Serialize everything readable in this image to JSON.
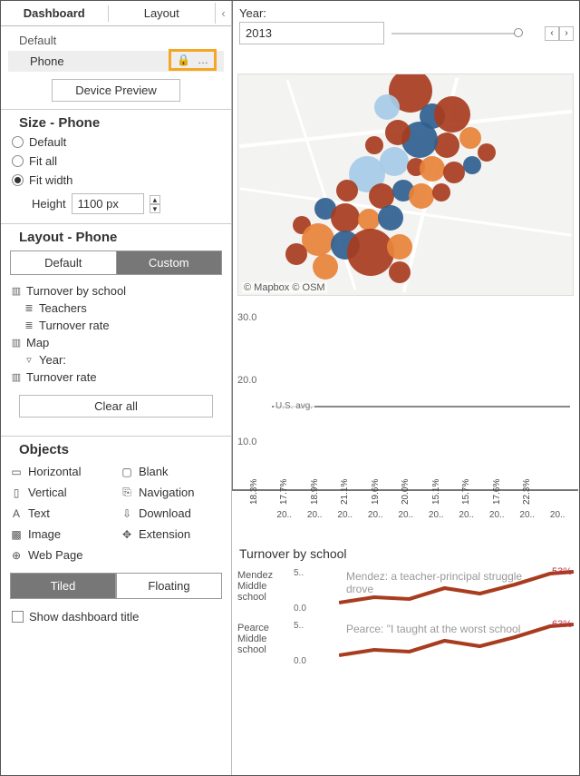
{
  "tabs": {
    "dashboard": "Dashboard",
    "layout": "Layout",
    "collapse": "‹"
  },
  "devices": {
    "default": "Default",
    "phone": "Phone",
    "lock_icon": "🔒",
    "more_icon": "…",
    "preview_btn": "Device Preview"
  },
  "size": {
    "title": "Size - Phone",
    "opt_default": "Default",
    "opt_fitall": "Fit all",
    "opt_fitwidth": "Fit width",
    "height_label": "Height",
    "height_value": "1100 px"
  },
  "layout": {
    "title": "Layout - Phone",
    "seg_default": "Default",
    "seg_custom": "Custom",
    "tree": {
      "n1": "Turnover by school",
      "n2": "Teachers",
      "n3": "Turnover rate",
      "n4": "Map",
      "n5": "Year:",
      "n6": "Turnover rate"
    },
    "clear": "Clear all"
  },
  "objects": {
    "title": "Objects",
    "horizontal": "Horizontal",
    "blank": "Blank",
    "vertical": "Vertical",
    "navigation": "Navigation",
    "text": "Text",
    "download": "Download",
    "image": "Image",
    "extension": "Extension",
    "webpage": "Web Page",
    "tiled": "Tiled",
    "floating": "Floating",
    "show_title": "Show dashboard title"
  },
  "year": {
    "label": "Year:",
    "value": "2013"
  },
  "map": {
    "attrib": "© Mapbox © OSM"
  },
  "chart_data": {
    "type": "bar",
    "title": "",
    "ylabel": "",
    "ylim": [
      0,
      30
    ],
    "yticks": [
      10.0,
      20.0,
      30.0
    ],
    "reference_line": {
      "label": "U.S. avg.",
      "value": 15.9
    },
    "categories": [
      "20..",
      "20..",
      "20..",
      "20..",
      "20..",
      "20..",
      "20..",
      "20..",
      "20..",
      "20.."
    ],
    "values": [
      18.3,
      17.7,
      18.9,
      21.1,
      19.6,
      20.0,
      15.1,
      15.7,
      17.6,
      22.3
    ],
    "colors": [
      "#e8833a",
      "#e8833a",
      "#e8833a",
      "#a83c1e",
      "#e8833a",
      "#e8833a",
      "#a7cbe8",
      "#a7cbe8",
      "#e8833a",
      "#a83c1e"
    ]
  },
  "turnover": {
    "title": "Turnover by school",
    "schools": [
      {
        "name": "Mendez Middle school",
        "mini_top": "5..",
        "mini_bot": "0.0",
        "headline": "Mendez: a teacher-principal struggle drove",
        "value": "53%"
      },
      {
        "name": "Pearce Middle school",
        "mini_top": "5..",
        "mini_bot": "0.0",
        "headline": "Pearce: \"I taught at the worst school",
        "value": "63%"
      }
    ]
  },
  "bubbles": [
    {
      "x": 190,
      "y": 18,
      "r": 24,
      "c": "#a83c1e"
    },
    {
      "x": 164,
      "y": 36,
      "r": 14,
      "c": "#a7cbe8"
    },
    {
      "x": 214,
      "y": 46,
      "r": 14,
      "c": "#2f5f8f"
    },
    {
      "x": 236,
      "y": 44,
      "r": 20,
      "c": "#a83c1e"
    },
    {
      "x": 256,
      "y": 70,
      "r": 12,
      "c": "#e8833a"
    },
    {
      "x": 230,
      "y": 78,
      "r": 14,
      "c": "#a83c1e"
    },
    {
      "x": 200,
      "y": 72,
      "r": 20,
      "c": "#2f5f8f"
    },
    {
      "x": 176,
      "y": 64,
      "r": 14,
      "c": "#a83c1e"
    },
    {
      "x": 150,
      "y": 78,
      "r": 10,
      "c": "#a83c1e"
    },
    {
      "x": 172,
      "y": 96,
      "r": 16,
      "c": "#a7cbe8"
    },
    {
      "x": 196,
      "y": 102,
      "r": 10,
      "c": "#a83c1e"
    },
    {
      "x": 214,
      "y": 104,
      "r": 14,
      "c": "#e8833a"
    },
    {
      "x": 238,
      "y": 108,
      "r": 12,
      "c": "#a83c1e"
    },
    {
      "x": 258,
      "y": 100,
      "r": 10,
      "c": "#2f5f8f"
    },
    {
      "x": 274,
      "y": 86,
      "r": 10,
      "c": "#a83c1e"
    },
    {
      "x": 142,
      "y": 110,
      "r": 20,
      "c": "#a7cbe8"
    },
    {
      "x": 120,
      "y": 128,
      "r": 12,
      "c": "#a83c1e"
    },
    {
      "x": 158,
      "y": 134,
      "r": 14,
      "c": "#a83c1e"
    },
    {
      "x": 182,
      "y": 128,
      "r": 12,
      "c": "#2f5f8f"
    },
    {
      "x": 202,
      "y": 134,
      "r": 14,
      "c": "#e8833a"
    },
    {
      "x": 224,
      "y": 130,
      "r": 10,
      "c": "#a83c1e"
    },
    {
      "x": 96,
      "y": 148,
      "r": 12,
      "c": "#2f5f8f"
    },
    {
      "x": 118,
      "y": 158,
      "r": 16,
      "c": "#a83c1e"
    },
    {
      "x": 144,
      "y": 160,
      "r": 12,
      "c": "#e8833a"
    },
    {
      "x": 168,
      "y": 158,
      "r": 14,
      "c": "#2f5f8f"
    },
    {
      "x": 70,
      "y": 166,
      "r": 10,
      "c": "#a83c1e"
    },
    {
      "x": 88,
      "y": 182,
      "r": 18,
      "c": "#e8833a"
    },
    {
      "x": 118,
      "y": 188,
      "r": 16,
      "c": "#2f5f8f"
    },
    {
      "x": 146,
      "y": 196,
      "r": 26,
      "c": "#a83c1e"
    },
    {
      "x": 178,
      "y": 190,
      "r": 14,
      "c": "#e8833a"
    },
    {
      "x": 64,
      "y": 198,
      "r": 12,
      "c": "#a83c1e"
    },
    {
      "x": 96,
      "y": 212,
      "r": 14,
      "c": "#e8833a"
    },
    {
      "x": 178,
      "y": 218,
      "r": 12,
      "c": "#a83c1e"
    }
  ]
}
